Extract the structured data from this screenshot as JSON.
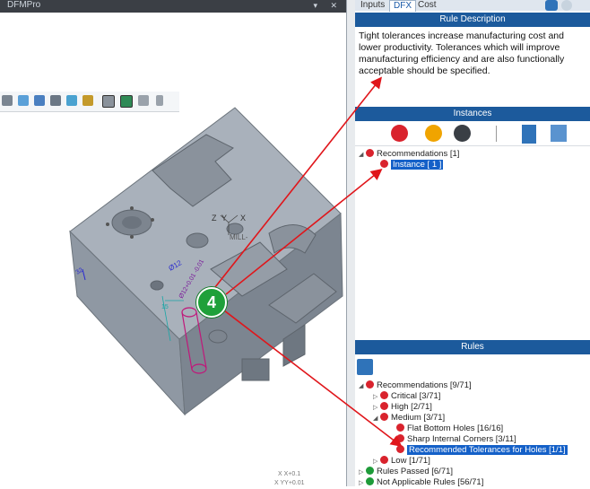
{
  "app": {
    "name": "DFMPro"
  },
  "tabs": [
    {
      "label": "Inputs"
    },
    {
      "label": "DFX"
    },
    {
      "label": "Cost"
    }
  ],
  "rule_description": {
    "header": "Rule Description",
    "text": "Tight tolerances increase manufacturing cost and lower productivity. Tolerances which will improve manufacturing efficiency and are also functionally acceptable should be specified."
  },
  "instances": {
    "header": "Instances",
    "root": "Recommendations [1]",
    "child": "Instance [ 1 ]"
  },
  "rules": {
    "header": "Rules",
    "recommendations": "Recommendations [9/71]",
    "critical": "Critical [3/71]",
    "high": "High [2/71]",
    "medium": "Medium [3/71]",
    "flat_bottom": "Flat Bottom Holes [16/16]",
    "sharp_corners": "Sharp Internal Corners [3/11]",
    "recommended_tol": "Recommended Tolerances for Holes [1/1]",
    "low": "Low [1/71]",
    "passed": "Rules Passed [6/71]",
    "not_applicable": "Not Applicable Rules [56/71]"
  },
  "model_labels": {
    "tol_a": "Ø12",
    "tol_b": "Ø12+0.01 -0.01",
    "axis_z": "Z",
    "axis_y": "Y",
    "axis_x": "X",
    "mill": "MILL-",
    "dim_15": "15",
    "dim_32": "32",
    "coord1": "X X+0.1",
    "coord2": "X YY+0.01"
  },
  "callout": {
    "number": "4"
  },
  "colors": {
    "header_blue": "#1c5a9c",
    "error_red": "#d9232d",
    "ok_green": "#1e9b39",
    "selection": "#1460c8",
    "arrow": "#e0161b"
  }
}
